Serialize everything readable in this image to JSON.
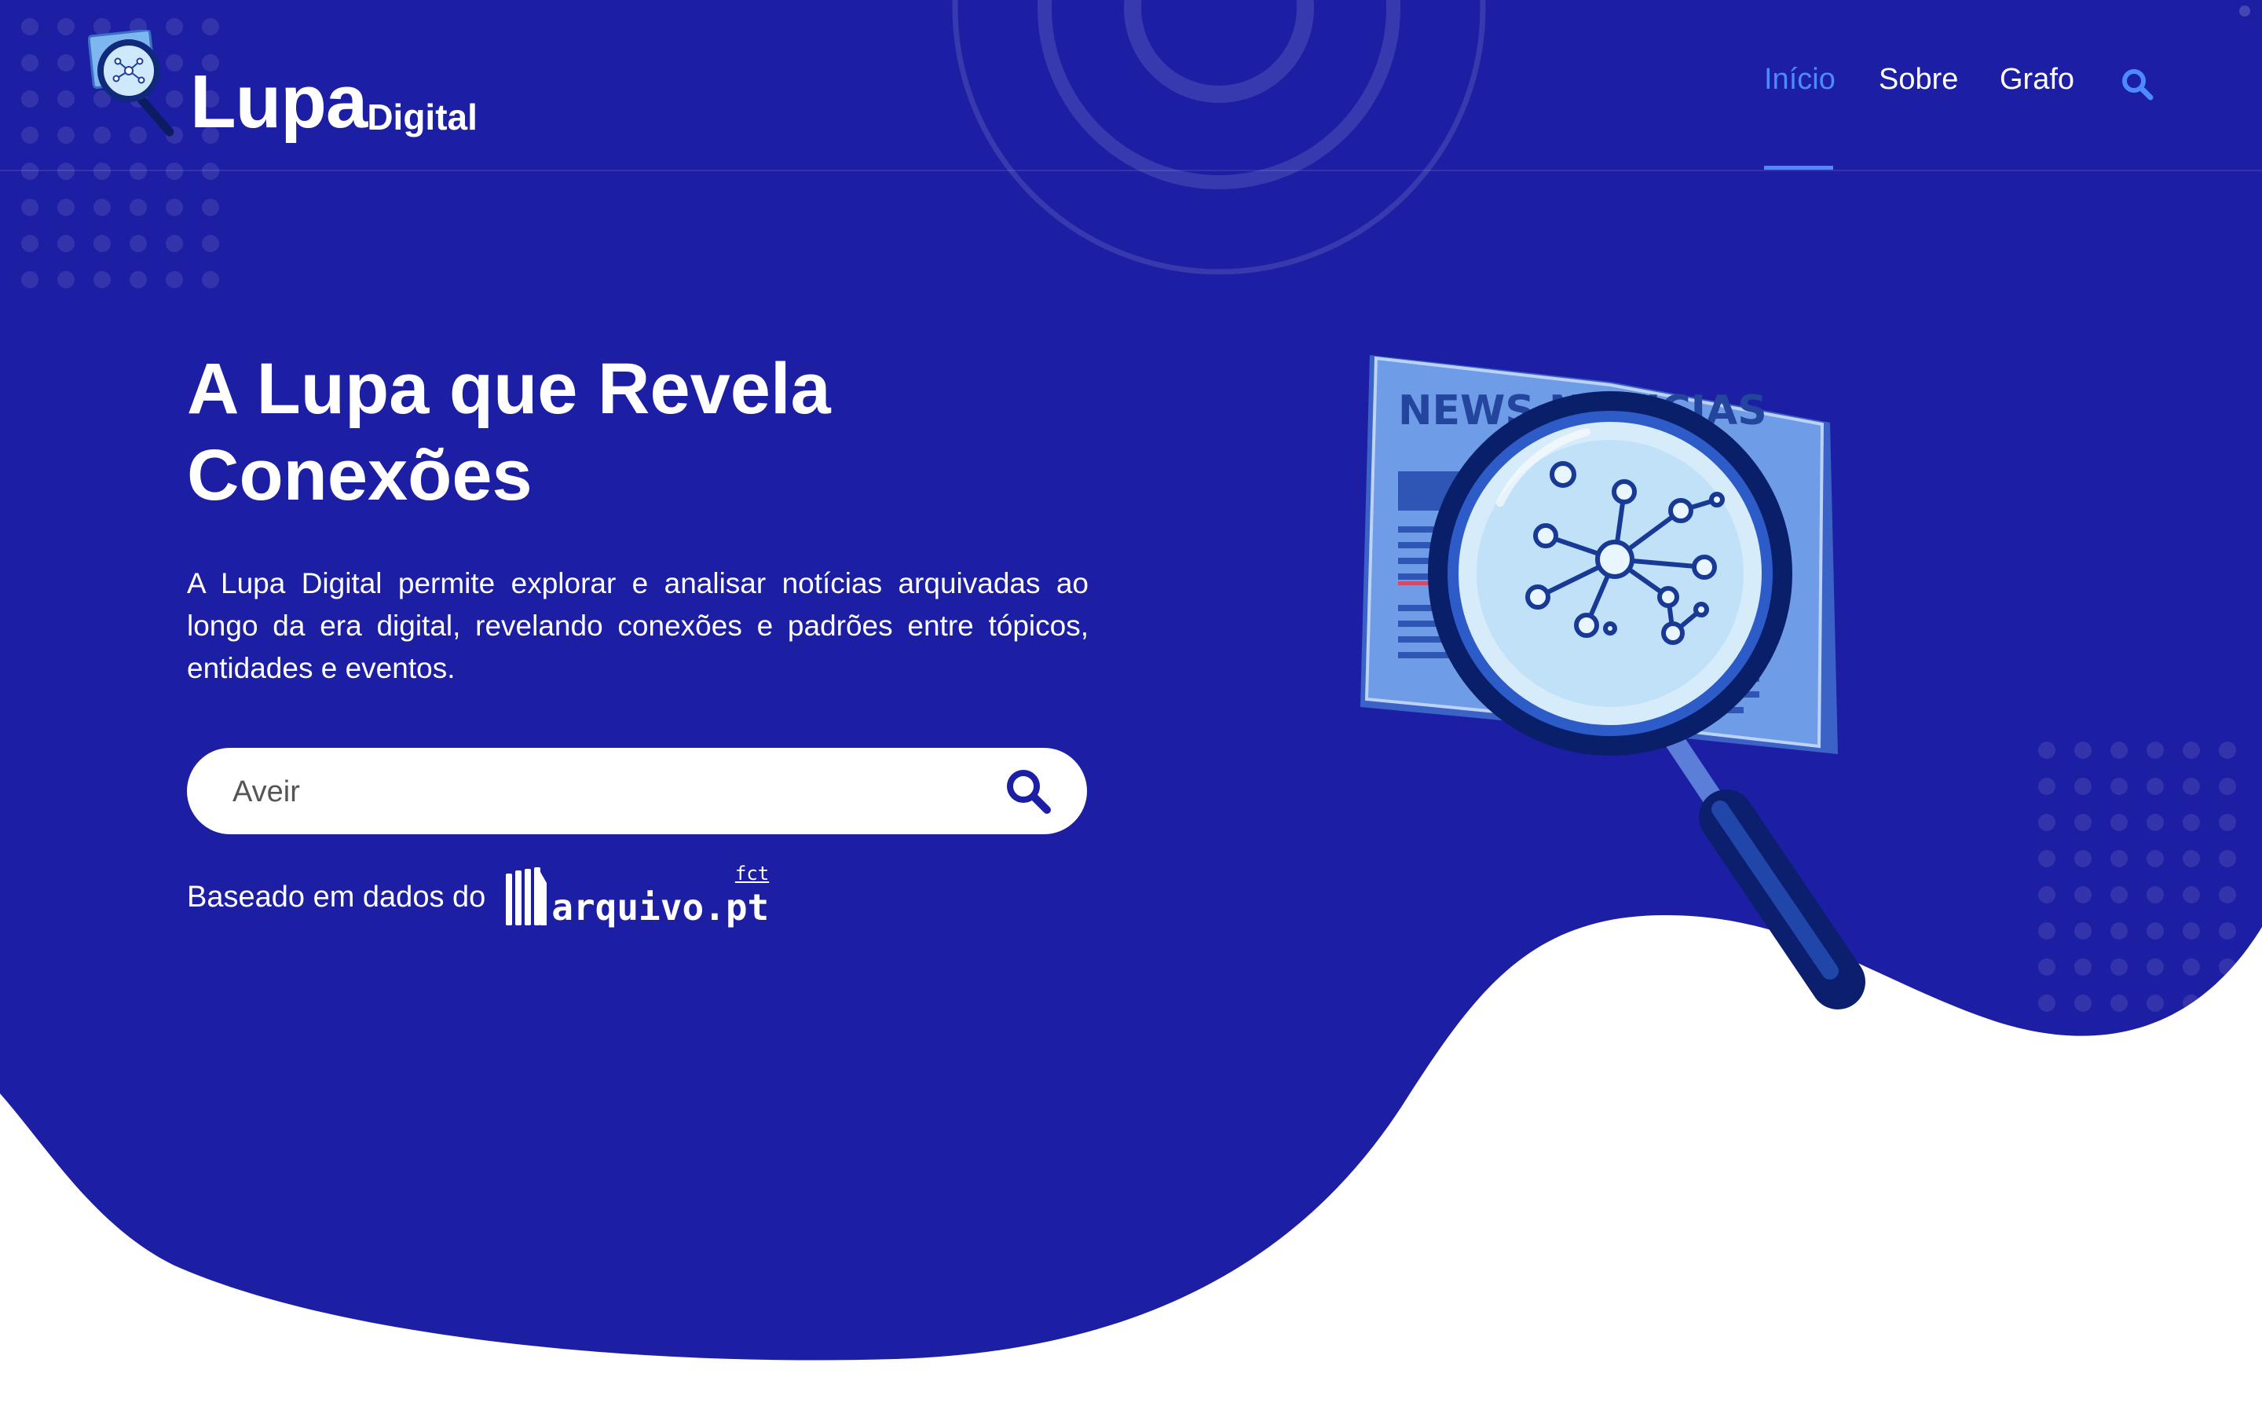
{
  "brand": {
    "name_main": "Lupa",
    "name_sub": "Digital"
  },
  "nav": {
    "items": [
      {
        "label": "Início",
        "active": true
      },
      {
        "label": "Sobre",
        "active": false
      },
      {
        "label": "Grafo",
        "active": false
      }
    ],
    "search_icon": "search-icon"
  },
  "hero": {
    "title_line1": "A Lupa que Revela",
    "title_line2": "Conexões",
    "description": "A Lupa Digital permite explorar e analisar notícias arquivadas ao longo da era digital, revelando conexões e padrões entre tópicos, entidades e eventos.",
    "search": {
      "value": "Aveir",
      "button_icon": "search-icon"
    },
    "based_on": "Baseado em dados do",
    "source_logo": {
      "text": "arquivo.pt",
      "badge": "fct"
    }
  },
  "illustration": {
    "newspaper_text": "NEWS NOTICIAS",
    "icon": "magnifier-network-icon"
  },
  "colors": {
    "background": "#1c1ea3",
    "accent": "#4d89ff",
    "wave": "#ffffff",
    "search_icon": "#1c1ea3"
  }
}
